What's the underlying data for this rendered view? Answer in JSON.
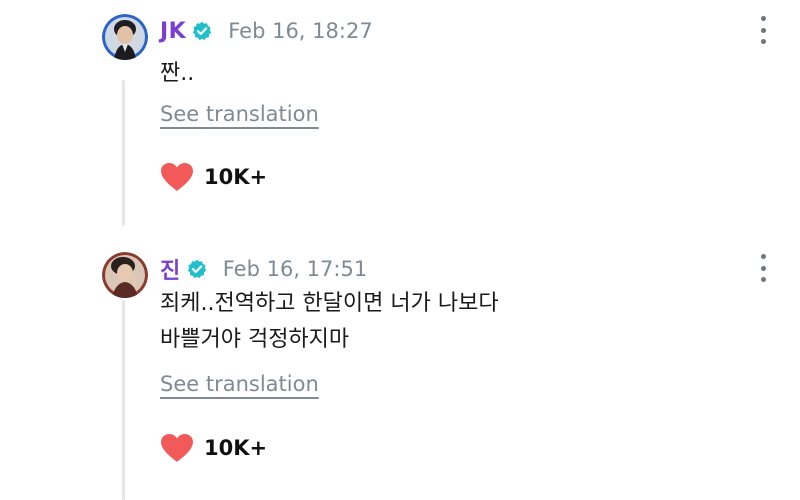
{
  "comments": [
    {
      "author": "JK",
      "date": "Feb 16, 18:27",
      "lines": [
        "짠.."
      ],
      "translate_label": "See translation",
      "like_count": "10K+"
    },
    {
      "author": "진",
      "date": "Feb 16, 17:51",
      "lines": [
        "죄케..전역하고 한달이면 너가 나보다",
        "바쁠거야 걱정하지마"
      ],
      "translate_label": "See translation",
      "like_count": "10K+"
    }
  ],
  "colors": {
    "author_name": "#7a3fd1",
    "verified_badge": "#1fc0c9",
    "date_text": "#7f8a94",
    "heart": "#f25a5a"
  },
  "icons": {
    "verified": "verified-badge-icon",
    "menu": "more-vertical-icon",
    "like": "heart-icon"
  }
}
